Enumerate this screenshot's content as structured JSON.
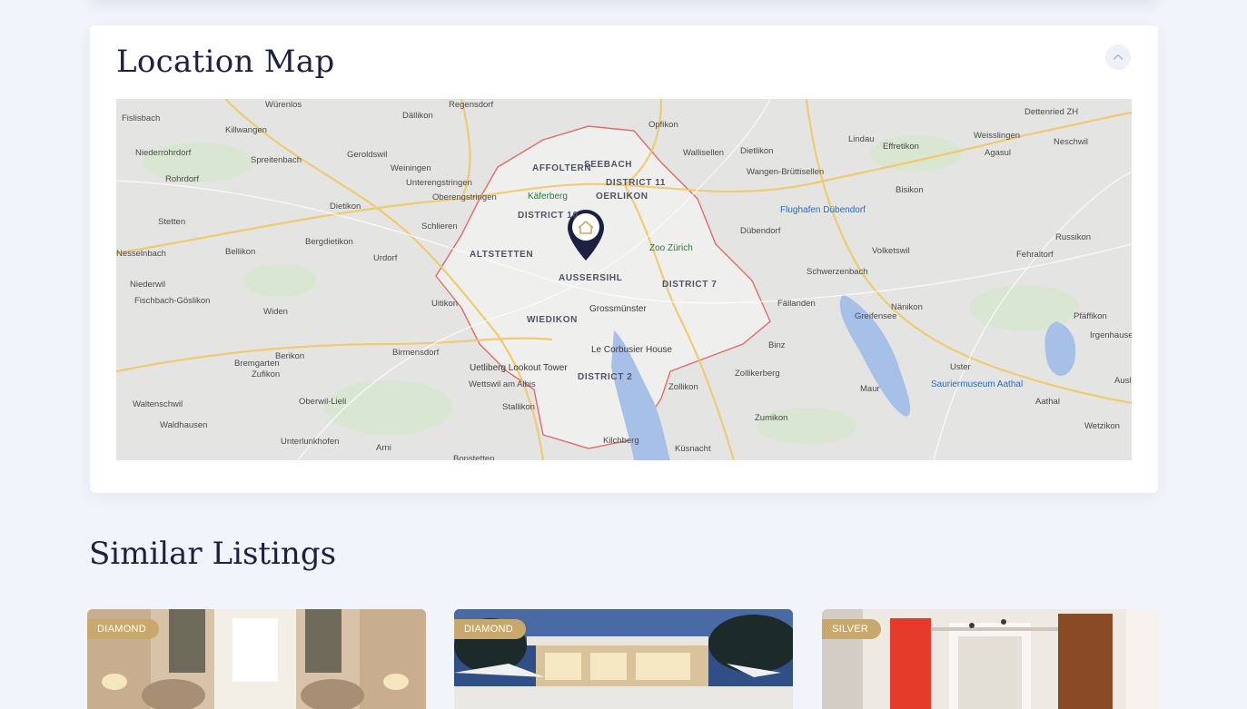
{
  "colors": {
    "background": "#f1f4fa",
    "heading": "#1d2141",
    "badge_gold": "#c9a96b",
    "marker": "#1d2141",
    "zone_border": "#e06b6b"
  },
  "map_section": {
    "title": "Location Map",
    "collapse_icon": "chevron-up-icon",
    "map": {
      "places": [
        "Würenlos",
        "Regensdorf",
        "Dällikon",
        "Opfikon",
        "Dettenried ZH",
        "Fislisbach",
        "Killwangen",
        "Geroldswil",
        "Seebach",
        "Dietlikon",
        "Lindau",
        "Weisslingen",
        "Neschwil",
        "Niederrohrdorf",
        "Spreitenbach",
        "Weiningen",
        "Unterengstringen",
        "Affoltern",
        "District 11",
        "Wallisellen",
        "Wangen-Brüttisellen",
        "Effretikon",
        "Agasul",
        "Rohrdorf",
        "Oberengstringen",
        "Käferberg",
        "Oerlikon",
        "Flughafen Dübendorf",
        "Bisikon",
        "Dietikon",
        "Stetten",
        "Schlieren",
        "District 10",
        "Dübendorf",
        "Russikon",
        "Bergdietikon",
        "Altstetten",
        "Zoo Zürich",
        "Volketswil",
        "Fehraltorf",
        "Bellikon",
        "Urdorf",
        "Aussersihl",
        "Schwerzenbach",
        "Nesselnbach",
        "District 7",
        "Niederwil",
        "Fällanden",
        "Nänikon",
        "Pfäffikon",
        "Fischbach-Göslikon",
        "Uitikon",
        "Widen",
        "Wiedikon",
        "Grossmünster",
        "Greifensee",
        "Irgenhausen",
        "Binz",
        "Le Corbusier House",
        "Berikon",
        "Birmensdorf",
        "Bremgarten",
        "Zufikon",
        "Uster",
        "Uetliberg Lookout Tower",
        "Zollikerberg",
        "Sauriermuseum Aathal",
        "Auslikon",
        "Wettswil am Albis",
        "District 2",
        "Maur",
        "Zollikon",
        "Aathal",
        "Oberwil-Lieli",
        "Waltenschwil",
        "Waldhausen",
        "Stallikon",
        "Zumikon",
        "Wetzikon",
        "Unterlunkhofen",
        "Arni",
        "Kilchberg",
        "Küsnacht",
        "Bonstetten"
      ]
    }
  },
  "similar_section": {
    "title": "Similar Listings",
    "listings": [
      {
        "badge": "DIAMOND"
      },
      {
        "badge": "DIAMOND"
      },
      {
        "badge": "SILVER"
      }
    ]
  }
}
